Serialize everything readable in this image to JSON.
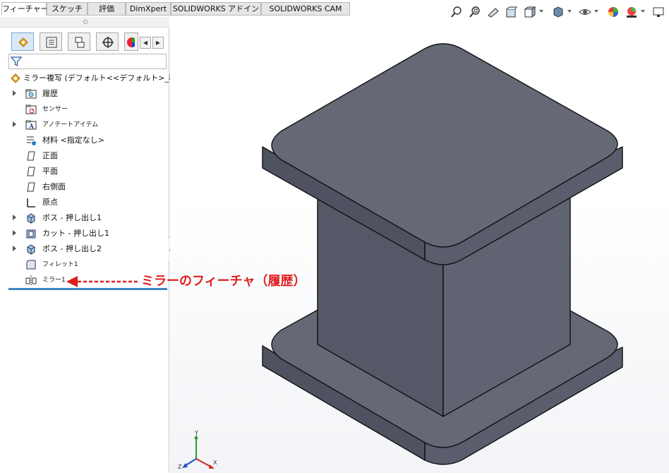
{
  "tabs": [
    {
      "label": "フィーチャー",
      "active": true
    },
    {
      "label": "スケッチ",
      "active": false
    },
    {
      "label": "評価",
      "active": false
    },
    {
      "label": "DimXpert",
      "active": false
    },
    {
      "label": "SOLIDWORKS アドイン",
      "active": false
    },
    {
      "label": "SOLIDWORKS CAM",
      "active": false
    }
  ],
  "panel_tabs": [
    "feature-manager-icon",
    "property-manager-icon",
    "configuration-manager-icon",
    "dimxpert-manager-icon",
    "display-manager-icon"
  ],
  "filter": {
    "icon": "filter-icon",
    "value": ""
  },
  "tree": {
    "root": {
      "label": "ミラー複写 (デフォルト<<デフォルト>_表示状態",
      "icon": "part-icon"
    },
    "items": [
      {
        "label": "履歴",
        "icon": "history-folder-icon",
        "expandable": true
      },
      {
        "label": "センサー",
        "icon": "sensor-folder-icon",
        "expandable": false
      },
      {
        "label": "アノテートアイテム",
        "icon": "annotation-folder-icon",
        "expandable": true
      },
      {
        "label": "材料 <指定なし>",
        "icon": "material-icon",
        "expandable": false
      },
      {
        "label": "正面",
        "icon": "plane-icon",
        "expandable": false
      },
      {
        "label": "平面",
        "icon": "plane-icon",
        "expandable": false
      },
      {
        "label": "右側面",
        "icon": "plane-icon",
        "expandable": false
      },
      {
        "label": "原点",
        "icon": "origin-icon",
        "expandable": false
      },
      {
        "label": "ボス - 押し出し1",
        "icon": "boss-extrude-icon",
        "expandable": true
      },
      {
        "label": "カット - 押し出し1",
        "icon": "cut-extrude-icon",
        "expandable": true
      },
      {
        "label": "ボス - 押し出し2",
        "icon": "boss-extrude-icon",
        "expandable": true
      },
      {
        "label": "フィレット1",
        "icon": "fillet-icon",
        "expandable": false
      },
      {
        "label": "ミラー1",
        "icon": "mirror-icon",
        "expandable": false
      }
    ]
  },
  "annotation": {
    "text": "ミラーのフィーチャ（履歴）",
    "color": "#e01e1e"
  },
  "view_toolbar_icons": [
    "zoom-to-fit-icon",
    "zoom-to-area-icon",
    "previous-view-icon",
    "section-view-icon",
    "view-orientation-icon",
    "display-style-icon",
    "hide-show-icon",
    "edit-appearance-icon",
    "apply-scene-icon",
    "view-settings-icon"
  ],
  "triad": {
    "x_label": "X",
    "y_label": "Y",
    "z_label": "Z"
  },
  "model_colors": {
    "face_top": "#656875",
    "face_dark": "#4f5260",
    "face_front": "#5a5d6b",
    "edge": "#111111"
  }
}
